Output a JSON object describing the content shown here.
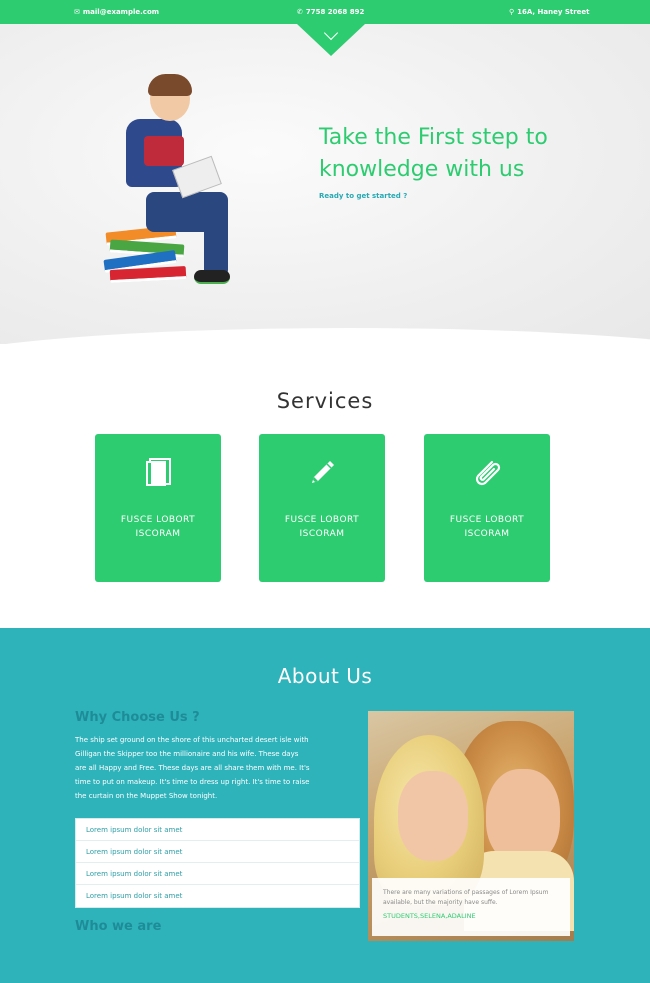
{
  "topbar": {
    "email": "mail@example.com",
    "phone": "7758 2068 892",
    "address": "16A, Haney Street",
    "icons": {
      "email": "envelope-icon",
      "phone": "phone-icon",
      "address": "map-pin-icon"
    }
  },
  "hero": {
    "title": "Take the First step to knowledge with us",
    "subtitle": "Ready to get started ?"
  },
  "services": {
    "title": "Services",
    "cards": [
      {
        "icon": "book-icon",
        "label": "FUSCE LOBORT ISCORAM"
      },
      {
        "icon": "pencil-icon",
        "label": "FUSCE LOBORT ISCORAM"
      },
      {
        "icon": "paperclip-icon",
        "label": "FUSCE LOBORT ISCORAM"
      }
    ]
  },
  "about": {
    "title": "About Us",
    "why_heading": "Why Choose Us ?",
    "paragraph": "The ship set ground on the shore of this uncharted desert isle with Gilligan the Skipper too the millionaire and his wife. These days are all Happy and Free. These days are all share them with me. It's time to put on makeup. It's time to dress up right. It's time to raise the curtain on the Muppet Show tonight.",
    "list": [
      "Lorem ipsum dolor sit amet",
      "Lorem ipsum dolor sit amet",
      "Lorem ipsum dolor sit amet",
      "Lorem ipsum dolor sit amet"
    ],
    "who_heading": "Who we are",
    "caption_text": "There are many variations of passages of Lorem Ipsum available, but the majority have suffe.",
    "caption_name": "STUDENTS,SELENA,ADALINE"
  },
  "colors": {
    "brand_green": "#2ecc71",
    "about_teal": "#2fb3bb",
    "heading_teal": "#1e8c98"
  }
}
